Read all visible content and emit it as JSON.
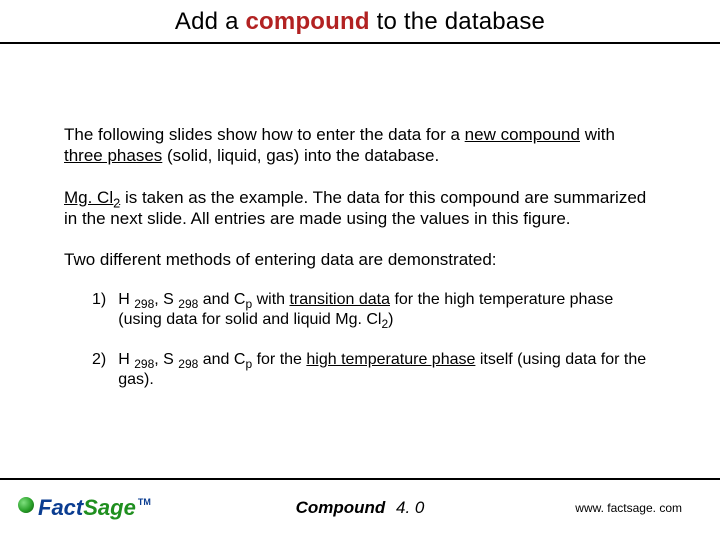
{
  "title": {
    "pre": "Add a ",
    "keyword": "compound",
    "post": " to the database"
  },
  "paragraphs": {
    "p1_a": "The following slides show how to enter the data for a ",
    "p1_u1": "new compound",
    "p1_b": " with ",
    "p1_u2": "three phases",
    "p1_c": " (solid, liquid, gas) into the database.",
    "p2_a": "Mg. Cl",
    "p2_sub": "2",
    "p2_b": " is taken as the example. The data for this compound are summarized in the next slide. All entries are made using the values in this figure.",
    "p3": "Two different methods of entering data are demonstrated:"
  },
  "list": {
    "n1": "1)",
    "i1_a": "H ",
    "i1_s1": "298",
    "i1_b": ", S ",
    "i1_s2": "298",
    "i1_c": " and C",
    "i1_s3": "p",
    "i1_d": " with ",
    "i1_u": "transition data",
    "i1_e": " for the high temperature phase (using data for solid and liquid Mg. Cl",
    "i1_s4": "2",
    "i1_f": ")",
    "n2": "2)",
    "i2_a": "H ",
    "i2_s1": "298",
    "i2_b": ", S ",
    "i2_s2": "298",
    "i2_c": " and C",
    "i2_s3": "p",
    "i2_d": " for the ",
    "i2_u": "high temperature phase",
    "i2_e": " itself (using data for the gas)."
  },
  "footer": {
    "logo_fact": "Fact",
    "logo_sage": "Sage",
    "logo_tm": "TM",
    "compound_label": "Compound",
    "version": "4. 0",
    "url": "www. factsage. com"
  }
}
